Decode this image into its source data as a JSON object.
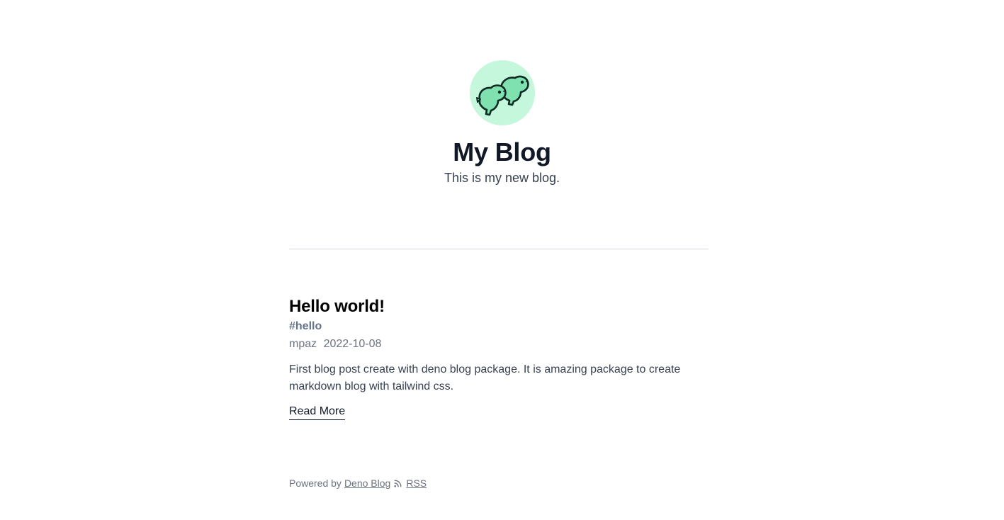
{
  "header": {
    "avatar_icon": "dino-pair-icon",
    "title": "My Blog",
    "description": "This is my new blog."
  },
  "posts": [
    {
      "title": "Hello world!",
      "tag": "#hello",
      "author": "mpaz",
      "date": "2022-10-08",
      "excerpt": "First blog post create with deno blog package. It is amazing package to create markdown blog with tailwind css.",
      "read_more": "Read More"
    }
  ],
  "footer": {
    "powered_by": "Powered by",
    "powered_link": "Deno Blog",
    "rss_icon": "rss-icon",
    "rss_label": "RSS"
  },
  "colors": {
    "avatar_bg": "#c5f7dd",
    "dino_fill": "#7fe0b0",
    "dino_stroke": "#0f2a22",
    "title": "#111827",
    "tag": "#64748b",
    "meta": "#6b7280"
  }
}
